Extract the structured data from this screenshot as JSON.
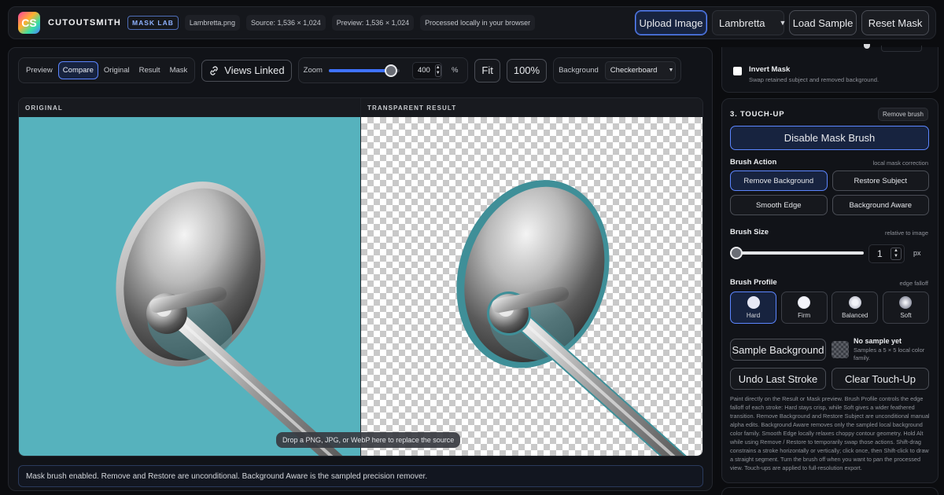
{
  "header": {
    "logo_text": "CS",
    "brand": "CUTOUTSMITH",
    "lab_badge": "MASK LAB",
    "file_name": "Lambretta.png",
    "source_size": "Source: 1,536 × 1,024",
    "preview_size": "Preview: 1,536 × 1,024",
    "processing_note": "Processed locally in your browser",
    "upload_label": "Upload Image",
    "sample_select_value": "Lambretta",
    "load_sample_label": "Load Sample",
    "reset_mask_label": "Reset Mask"
  },
  "toolbar": {
    "view_modes": [
      "Preview",
      "Compare",
      "Original",
      "Result",
      "Mask"
    ],
    "active_view": "Compare",
    "views_linked_label": "Views Linked",
    "zoom_label": "Zoom",
    "zoom_value": "400",
    "zoom_unit": "%",
    "zoom_fraction": 0.88,
    "fit_label": "Fit",
    "hundred_label": "100%",
    "background_label": "Background",
    "background_value": "Checkerboard"
  },
  "view": {
    "original_title": "ORIGINAL",
    "result_title": "TRANSPARENT RESULT",
    "drop_tip": "Drop a PNG, JPG, or WebP here to replace the source"
  },
  "status": "Mask brush enabled. Remove and Restore are unconditional. Background Aware is the sampled precision remover.",
  "sidebar": {
    "invert_title": "Invert Mask",
    "invert_desc": "Swap retained subject and removed background.",
    "touchup_title": "3. TOUCH-UP",
    "remove_brush_tag": "Remove brush",
    "disable_brush_label": "Disable Mask Brush",
    "brush_action_title": "Brush Action",
    "brush_action_hint": "local mask correction",
    "actions": [
      "Remove Background",
      "Restore Subject",
      "Smooth Edge",
      "Background Aware"
    ],
    "active_action": "Remove Background",
    "brush_size_title": "Brush Size",
    "brush_size_hint": "relative to image",
    "brush_size_value": "1",
    "brush_size_unit": "px",
    "profile_title": "Brush Profile",
    "profile_hint": "edge falloff",
    "profiles": [
      "Hard",
      "Firm",
      "Balanced",
      "Soft"
    ],
    "active_profile": "Hard",
    "sample_bg_label": "Sample Background",
    "no_sample_title": "No sample yet",
    "no_sample_desc": "Samples a 5 × 5 local color family.",
    "undo_label": "Undo Last Stroke",
    "clear_label": "Clear Touch-Up",
    "help_text": "Paint directly on the Result or Mask preview. Brush Profile controls the edge falloff of each stroke: Hard stays crisp, while Soft gives a wider feathered transition. Remove Background and Restore Subject are unconditional manual alpha edits. Background Aware removes only the sampled local background color family. Smooth Edge locally relaxes choppy contour geometry. Hold Alt while using Remove / Restore to temporarily swap those actions. Shift-drag constrains a stroke horizontally or vertically; click once, then Shift-click to draw a straight segment. Turn the brush off when you want to pan the processed view. Touch-ups are applied to full-resolution export."
  },
  "colors": {
    "accent": "#5c86ff",
    "teal_bg": "#56b2bd"
  }
}
